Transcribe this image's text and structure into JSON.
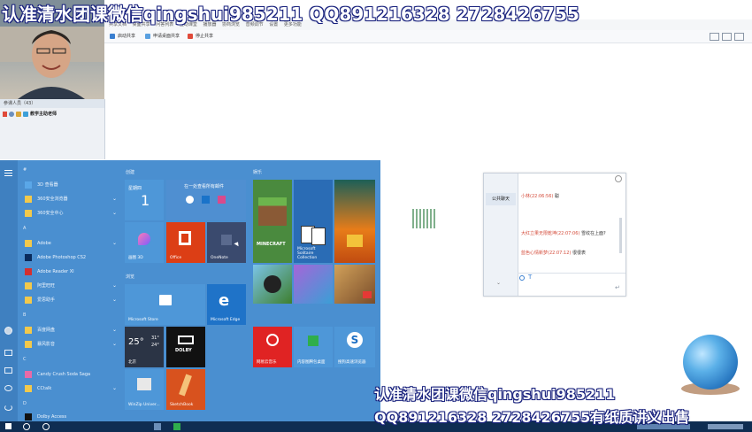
{
  "watermark": {
    "top": "认准清水团课微信qingshui985211   QQ891216328  2728426755",
    "bottom_line1": "认准清水团课微信qingshui985211",
    "bottom_line2": "QQ891216328  2728426755有纸质讲义出售"
  },
  "participants": {
    "header": "参课人员（43）",
    "row_name": "教学主助老师"
  },
  "menubar": [
    "共享文档",
    "桌面共享",
    "问答列表",
    "互动课堂",
    "播放器",
    "协商浏览",
    "音频调节",
    "设置",
    "更多功能"
  ],
  "toolbar": {
    "btn1": "启动共享",
    "btn2": "申请桌面共享",
    "btn3": "停止共享"
  },
  "startmenu": {
    "group_create": "创建",
    "group_play": "娱乐",
    "group_browse": "浏览",
    "letters": [
      "#",
      "A",
      "B",
      "C",
      "D"
    ],
    "apps": [
      {
        "label": "3D 查看器",
        "chev": false
      },
      {
        "label": "360安全浏览器",
        "chev": true
      },
      {
        "label": "360安全中心",
        "chev": true
      },
      {
        "label": "Adobe",
        "chev": true
      },
      {
        "label": "Adobe Photoshop CS2",
        "chev": false
      },
      {
        "label": "Adobe Reader XI",
        "chev": false
      },
      {
        "label": "阿里旺旺",
        "chev": true
      },
      {
        "label": "爱思助手",
        "chev": true
      },
      {
        "label": "百度网盘",
        "chev": true
      },
      {
        "label": "暴风影音",
        "chev": true
      },
      {
        "label": "Candy Crush Soda Saga",
        "chev": false
      },
      {
        "label": "CCtalk",
        "chev": true
      },
      {
        "label": "Dolby Access",
        "chev": false
      }
    ],
    "tiles": {
      "calendar_day": "星期四",
      "calendar_date": "1",
      "mail_header": "在一处查看所有邮件",
      "paint3d": "画图 3D",
      "office": "Office",
      "onenote": "OneNote",
      "minecraft": "MINECRAFT",
      "solitaire": "Microsoft Solitaire Collection",
      "store": "Microsoft Store",
      "edge": "Microsoft Edge",
      "weather_temp": "25°",
      "weather_hi": "31°",
      "weather_lo": "24°",
      "weather_city": "北京",
      "dolby": "DOLBY",
      "netease": "网易云音乐",
      "zhuangshi": "内容图腾包桌面",
      "sogou": "搜狗高速浏览器",
      "winzip": "WinZip Univer...",
      "sketchbook": "SketchBook"
    }
  },
  "chat": {
    "tab": "公共聊天",
    "messages": [
      {
        "name": "小林(22:06:56)",
        "text": "聪",
        "color": "red"
      },
      {
        "name": "大红立果无限乾坤(22:07:06)",
        "text": "雪纹在上面?",
        "color": "red"
      },
      {
        "name": "蓝色心情新梦(22:07:12)",
        "text": "很很表",
        "color": "red"
      }
    ]
  },
  "colors": {
    "start_bg": "#4a8fd0",
    "taskbar": "#0f2d52",
    "watermark_outline": "#1a237e"
  }
}
